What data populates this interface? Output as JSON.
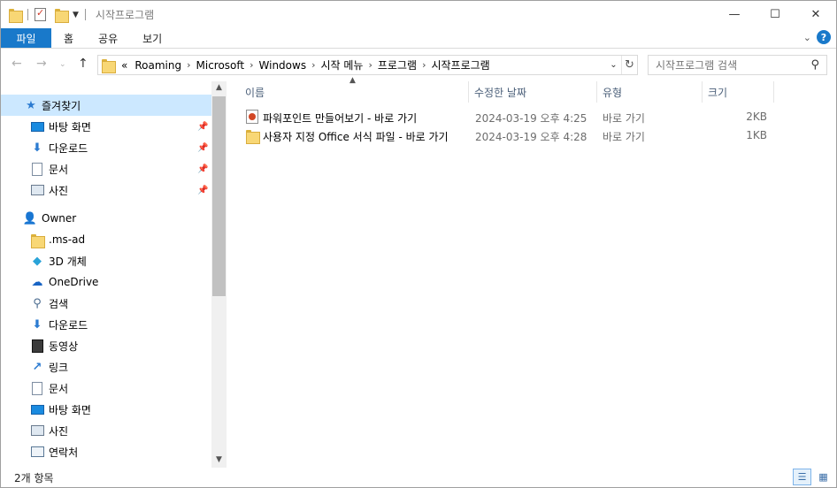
{
  "window": {
    "title": "시작프로그램",
    "min_icon": "minimize-icon",
    "max_icon": "maximize-icon",
    "close_icon": "close-icon"
  },
  "ribbon": {
    "tabs": [
      {
        "label": "파일"
      },
      {
        "label": "홈"
      },
      {
        "label": "공유"
      },
      {
        "label": "보기"
      }
    ],
    "accent": "#1979ca"
  },
  "address": {
    "crumbs": [
      "«",
      "Roaming",
      "Microsoft",
      "Windows",
      "시작 메뉴",
      "프로그램",
      "시작프로그램"
    ],
    "separator": "›"
  },
  "search": {
    "placeholder": "시작프로그램 검색"
  },
  "nav": {
    "items": [
      {
        "label": "즐겨찾기",
        "icon": "star-icon",
        "pinned": false
      },
      {
        "label": "바탕 화면",
        "icon": "desktop-icon",
        "pinned": true
      },
      {
        "label": "다운로드",
        "icon": "download-icon",
        "pinned": true
      },
      {
        "label": "문서",
        "icon": "document-icon",
        "pinned": true
      },
      {
        "label": "사진",
        "icon": "pictures-icon",
        "pinned": true
      },
      {
        "label": "Owner",
        "icon": "user-icon",
        "pinned": false
      },
      {
        "label": ".ms-ad",
        "icon": "folder-icon",
        "pinned": false
      },
      {
        "label": "3D 개체",
        "icon": "3d-objects-icon",
        "pinned": false
      },
      {
        "label": "OneDrive",
        "icon": "cloud-icon",
        "pinned": false
      },
      {
        "label": "검색",
        "icon": "search-icon",
        "pinned": false
      },
      {
        "label": "다운로드",
        "icon": "download-icon",
        "pinned": false
      },
      {
        "label": "동영상",
        "icon": "video-icon",
        "pinned": false
      },
      {
        "label": "링크",
        "icon": "link-icon",
        "pinned": false
      },
      {
        "label": "문서",
        "icon": "document-icon",
        "pinned": false
      },
      {
        "label": "바탕 화면",
        "icon": "desktop-icon",
        "pinned": false
      },
      {
        "label": "사진",
        "icon": "pictures-icon",
        "pinned": false
      },
      {
        "label": "연락처",
        "icon": "contacts-icon",
        "pinned": false
      }
    ]
  },
  "columns": {
    "name": "이름",
    "date": "수정한 날짜",
    "type": "유형",
    "size": "크기"
  },
  "files": [
    {
      "name": "파워포인트 만들어보기 - 바로 가기",
      "date": "2024-03-19 오후 4:25",
      "type": "바로 가기",
      "size": "2KB",
      "icon": "powerpoint-shortcut-icon"
    },
    {
      "name": "사용자 지정 Office 서식 파일 - 바로 가기",
      "date": "2024-03-19 오후 4:28",
      "type": "바로 가기",
      "size": "1KB",
      "icon": "folder-shortcut-icon"
    }
  ],
  "status": {
    "count": "2개 항목"
  }
}
